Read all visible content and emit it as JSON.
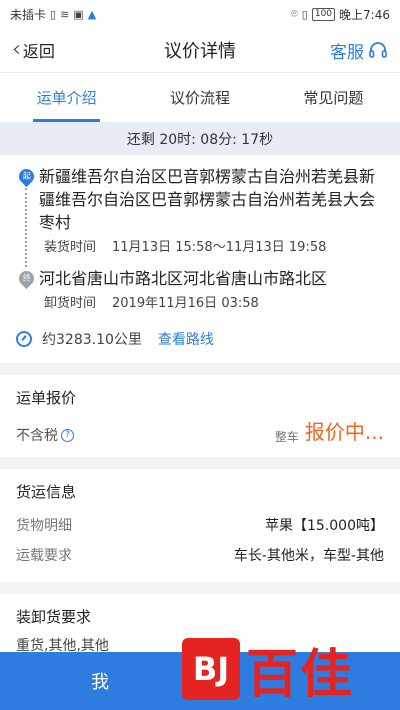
{
  "status_bar": {
    "carrier": "未插卡",
    "battery": "100",
    "time": "晚上7:46"
  },
  "nav": {
    "back_label": "返回",
    "title": "议价详情",
    "service_label": "客服"
  },
  "tabs": [
    {
      "label": "运单介绍",
      "active": true
    },
    {
      "label": "议价流程",
      "active": false
    },
    {
      "label": "常见问题",
      "active": false
    }
  ],
  "timer": "还剩 20时: 08分: 17秒",
  "route": {
    "start_badge": "起",
    "start_address": "新疆维吾尔自治区巴音郭楞蒙古自治州若羌县新疆维吾尔自治区巴音郭楞蒙古自治州若羌县大会枣村",
    "load_label": "装货时间",
    "load_time": "11月13日 15:58～11月13日 19:58",
    "end_badge": "终",
    "end_address": "河北省唐山市路北区河北省唐山市路北区",
    "unload_label": "卸货时间",
    "unload_time": "2019年11月16日 03:58",
    "distance": "约3283.10公里",
    "view_route": "查看路线"
  },
  "quote": {
    "title": "运单报价",
    "tax_label": "不含税",
    "type_label": "整车",
    "status": "报价中..."
  },
  "cargo": {
    "title": "货运信息",
    "rows": [
      {
        "key": "货物明细",
        "value": "苹果【15.000吨】"
      },
      {
        "key": "运载要求",
        "value": "车长-其他米，车型-其他"
      }
    ]
  },
  "loading": {
    "title": "装卸货要求",
    "text": "重货,其他,其他"
  },
  "bottom_button": "我",
  "watermark": {
    "logo": "BJ",
    "text": "百佳"
  },
  "colors": {
    "accent": "#2d7de0",
    "price": "#f26522",
    "watermark": "#e52421"
  }
}
